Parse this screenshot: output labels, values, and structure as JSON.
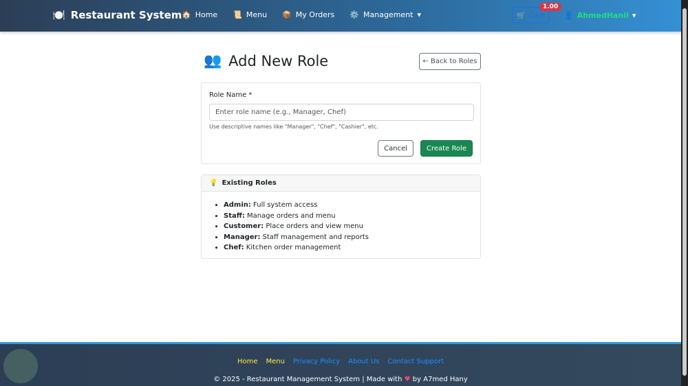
{
  "nav": {
    "brand": "Restaurant System",
    "links": [
      {
        "icon": "🏠",
        "label": "Home"
      },
      {
        "icon": "📜",
        "label": "Menu"
      },
      {
        "icon": "📦",
        "label": "My Orders"
      },
      {
        "icon": "⚙️",
        "label": "Management"
      }
    ],
    "cart_label": "Cart",
    "cart_badge": "1.00",
    "user": "AhmedHanii"
  },
  "page": {
    "title": "Add New Role",
    "back": "← Back to Roles"
  },
  "form": {
    "label": "Role Name *",
    "placeholder": "Enter role name (e.g., Manager, Chef)",
    "help": "Use descriptive names like \"Manager\", \"Chef\", \"Cashier\", etc.",
    "cancel": "Cancel",
    "create": "Create Role"
  },
  "roles": {
    "title": "Existing Roles",
    "items": [
      {
        "name": "Admin:",
        "desc": " Full system access"
      },
      {
        "name": "Staff:",
        "desc": " Manage orders and menu"
      },
      {
        "name": "Customer:",
        "desc": " Place orders and view menu"
      },
      {
        "name": "Manager:",
        "desc": " Staff management and reports"
      },
      {
        "name": "Chef:",
        "desc": " Kitchen order management"
      }
    ]
  },
  "footer": {
    "links": [
      {
        "label": "Home",
        "color": "#ffeb3b"
      },
      {
        "label": "Menu",
        "color": "#ffeb3b"
      },
      {
        "label": "Privacy Policy",
        "color": "#1e90ff"
      },
      {
        "label": "About Us",
        "color": "#1e90ff"
      },
      {
        "label": "Contact Support",
        "color": "#1e90ff"
      }
    ],
    "copy_a": "© 2025 - Restaurant Management System | Made with",
    "copy_b": "by A7med Hany"
  }
}
